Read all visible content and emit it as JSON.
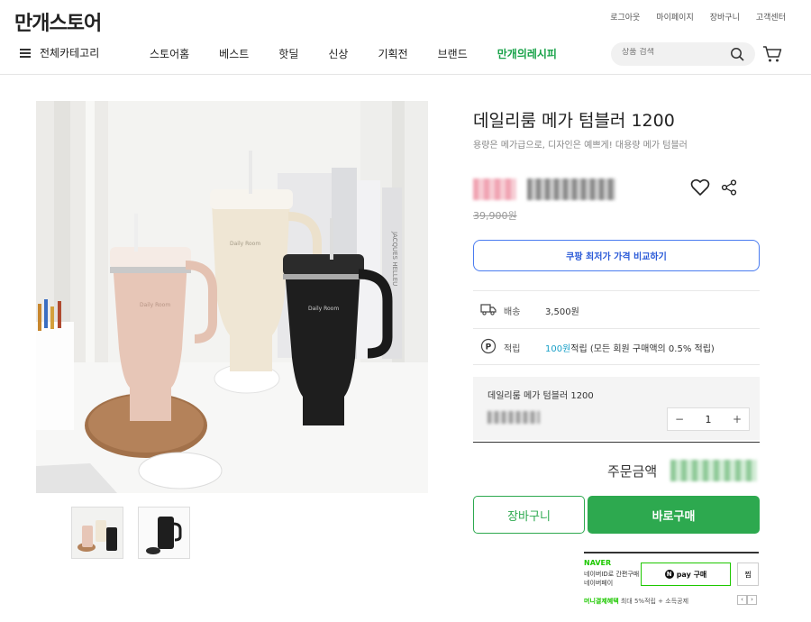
{
  "header": {
    "logo": "만개스토어",
    "util_links": [
      "로그아웃",
      "마이페이지",
      "장바구니",
      "고객센터"
    ],
    "category_label": "전체카테고리",
    "menu": [
      "스토어홈",
      "베스트",
      "핫딜",
      "신상",
      "기획전",
      "브랜드"
    ],
    "special_menu": "만개의레시피",
    "search_placeholder": "상품 검색"
  },
  "product": {
    "title": "데일리룸 메가 텀블러 1200",
    "subtitle": "용량은 메가급으로, 디자인은 예쁘게! 대용량 메가 텀블러",
    "original_price": "39,900원",
    "compare_button": "쿠팡 최저가 가격 비교하기",
    "shipping_label": "배송",
    "shipping_value": "3,500원",
    "points_label": "적립",
    "points_amount": "100원",
    "points_suffix": " 적립 (모든 회원 구매액의 0.5% 적립)",
    "option_name": "데일리룸 메가 텀블러 1200",
    "quantity": "1",
    "minus": "−",
    "plus": "+",
    "total_label": "주문금액",
    "cart_button": "장바구니",
    "buy_button": "바로구매",
    "tumbler_print": "Daily Room"
  },
  "naverpay": {
    "brand": "NAVER",
    "desc1": "네이버ID로 간편구매",
    "desc2": "네이버페이",
    "pay_badge": "N",
    "pay_button": "pay 구매",
    "zzim": "찜",
    "benefit_bold": "머니결제혜택",
    "benefit_rest": " 최대 5%적립 + 소득공제",
    "prev": "‹",
    "next": "›"
  },
  "colors": {
    "accent_green": "#2da94f",
    "compare_blue": "#4a7cf0",
    "points_blue": "#1aa0c8",
    "naver_green": "#1ec800"
  },
  "icons": [
    "menu-icon",
    "search-icon",
    "cart-icon",
    "heart-icon",
    "share-icon",
    "truck-icon",
    "point-icon"
  ]
}
